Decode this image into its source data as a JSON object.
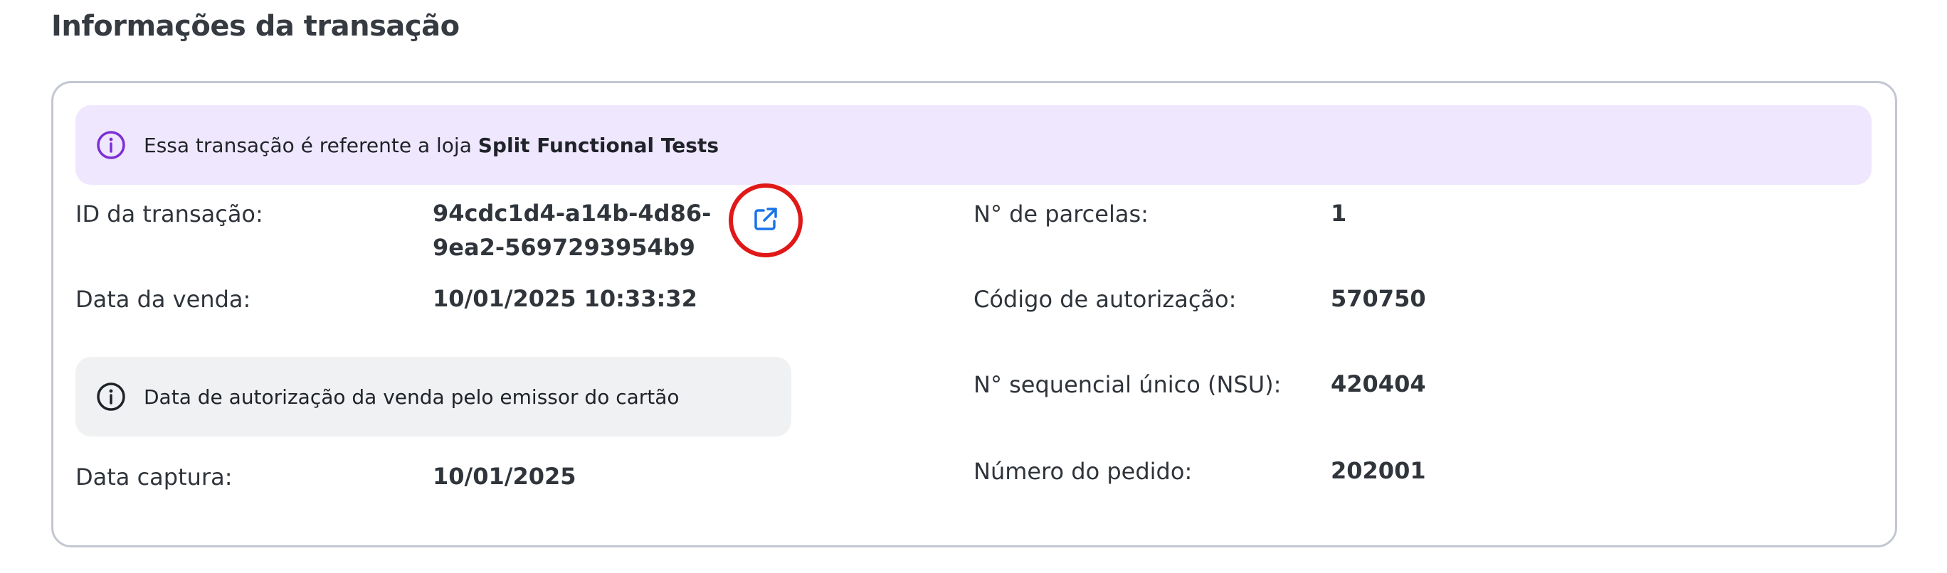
{
  "section": {
    "title": "Informações da transação"
  },
  "store_banner": {
    "prefix": "Essa transação é referente a loja ",
    "store_name": "Split Functional Tests",
    "icon": "info-icon",
    "accent_color": "#7b2fd6",
    "background_color": "#efe7fd"
  },
  "auth_banner": {
    "text": "Data de autorização da venda pelo emissor do cartão",
    "icon": "info-icon"
  },
  "left_fields": {
    "transaction_id": {
      "label": "ID da transação:",
      "value_line1": "94cdc1d4-a14b-4d86-",
      "value_line2": "9ea2-5697293954b9",
      "link_icon": "external-link-icon",
      "link_color": "#1a73e8"
    },
    "sale_date": {
      "label": "Data da venda:",
      "value": "10/01/2025 10:33:32"
    },
    "capture_date": {
      "label": "Data captura:",
      "value": "10/01/2025"
    }
  },
  "right_fields": {
    "installments": {
      "label": "N° de parcelas:",
      "value": "1"
    },
    "auth_code": {
      "label": "Código de autorização:",
      "value": "570750"
    },
    "nsu": {
      "label": "N° sequencial único (NSU):",
      "value": "420404"
    },
    "order_number": {
      "label": "Número do pedido:",
      "value": "202001"
    }
  },
  "highlight": {
    "target": "external-link-icon",
    "color": "#e01818"
  }
}
